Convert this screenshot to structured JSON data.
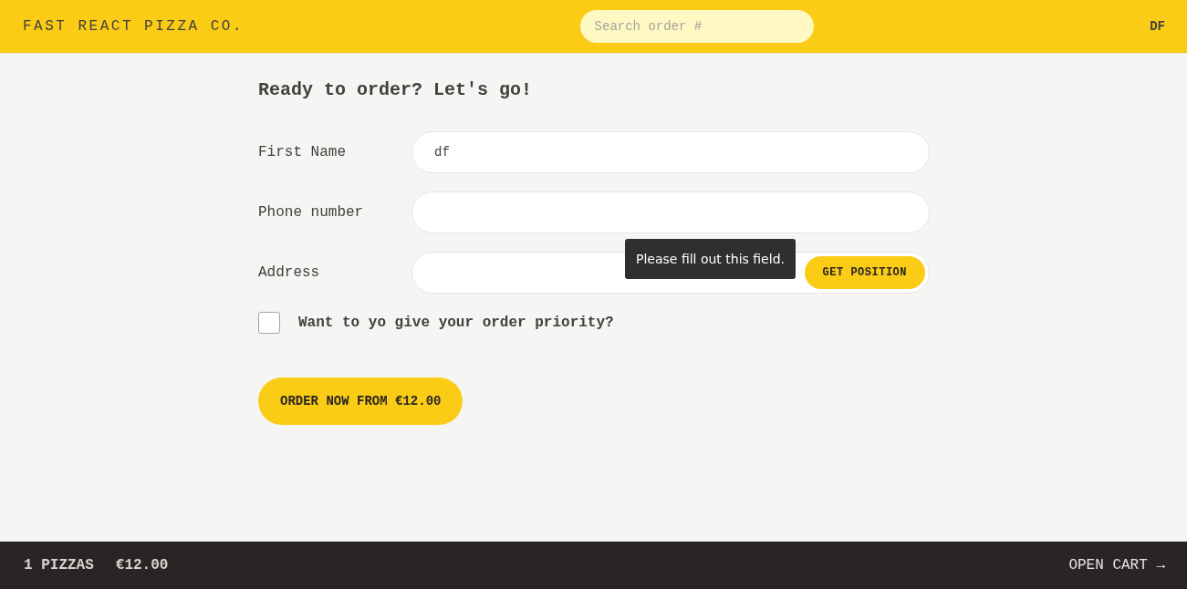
{
  "header": {
    "logo": "FAST REACT PIZZA CO.",
    "search": {
      "placeholder": "Search order #"
    },
    "username": "DF"
  },
  "form": {
    "title": "Ready to order? Let's go!",
    "fields": [
      {
        "kind": "text",
        "label": "First Name",
        "value": "df"
      },
      {
        "kind": "text",
        "label": "Phone number"
      },
      {
        "kind": "address",
        "label": "Address",
        "button": "GET POSITION",
        "tooltip": "Please fill out this field."
      }
    ],
    "priority": {
      "label": "Want to yo give your order priority?",
      "checked": false
    },
    "submit": "ORDER NOW FROM €12.00"
  },
  "cart_bar": {
    "count": "1 PIZZAS",
    "total": "€12.00",
    "link": "OPEN CART →"
  }
}
